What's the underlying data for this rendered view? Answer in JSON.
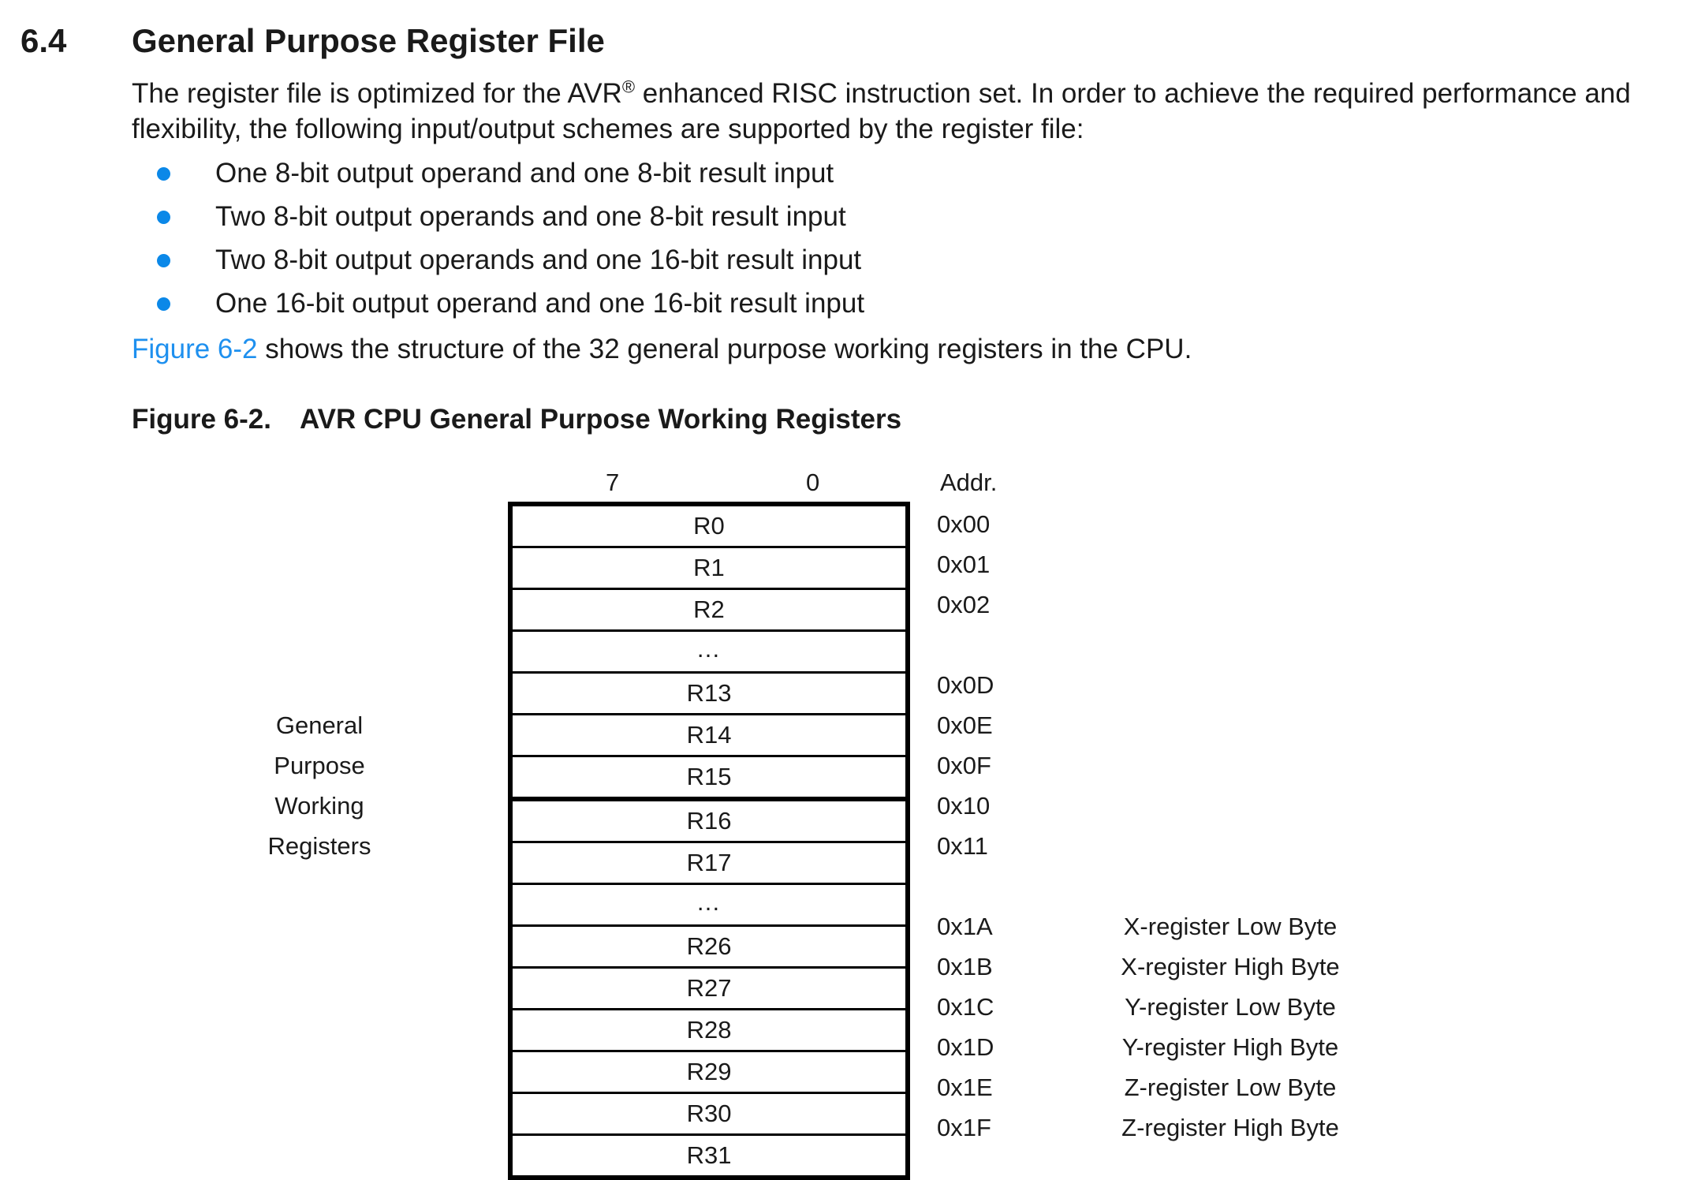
{
  "section": {
    "number": "6.4",
    "title": "General Purpose Register File"
  },
  "intro": {
    "part1": "The register file is optimized for the AVR",
    "registered_mark": "®",
    "part2": " enhanced RISC instruction set. In order to achieve the required performance and flexibility, the following input/output schemes are supported by the register file:"
  },
  "bullets": [
    "One 8-bit output operand and one 8-bit result input",
    "Two 8-bit output operands and one 8-bit result input",
    "Two 8-bit output operands and one 16-bit result input",
    "One 16-bit output operand and one 16-bit result input"
  ],
  "figure_ref": {
    "link_text": "Figure 6-2",
    "rest": " shows the structure of the 32 general purpose working registers in the CPU."
  },
  "figure": {
    "caption_number": "Figure 6-2.",
    "caption_title": "AVR CPU General Purpose Working Registers",
    "bit_high": "7",
    "bit_low": "0",
    "addr_header": "Addr.",
    "side_label": [
      "General",
      "Purpose",
      "Working",
      "Registers"
    ],
    "rows": [
      {
        "reg": "R0",
        "addr": "0x00",
        "desc": ""
      },
      {
        "reg": "R1",
        "addr": "0x01",
        "desc": ""
      },
      {
        "reg": "R2",
        "addr": "0x02",
        "desc": ""
      },
      {
        "reg": "…",
        "addr": "",
        "desc": ""
      },
      {
        "reg": "R13",
        "addr": "0x0D",
        "desc": ""
      },
      {
        "reg": "R14",
        "addr": "0x0E",
        "desc": ""
      },
      {
        "reg": "R15",
        "addr": "0x0F",
        "desc": ""
      },
      {
        "reg": "R16",
        "addr": "0x10",
        "desc": ""
      },
      {
        "reg": "R17",
        "addr": "0x11",
        "desc": ""
      },
      {
        "reg": "…",
        "addr": "",
        "desc": ""
      },
      {
        "reg": "R26",
        "addr": "0x1A",
        "desc": "X-register Low Byte"
      },
      {
        "reg": "R27",
        "addr": "0x1B",
        "desc": "X-register High Byte"
      },
      {
        "reg": "R28",
        "addr": "0x1C",
        "desc": "Y-register Low Byte"
      },
      {
        "reg": "R29",
        "addr": "0x1D",
        "desc": "Y-register High Byte"
      },
      {
        "reg": "R30",
        "addr": "0x1E",
        "desc": "Z-register Low Byte"
      },
      {
        "reg": "R31",
        "addr": "0x1F",
        "desc": "Z-register High Byte"
      }
    ]
  },
  "colors": {
    "bullet": "#0b88e8",
    "link": "#1e90ef"
  }
}
